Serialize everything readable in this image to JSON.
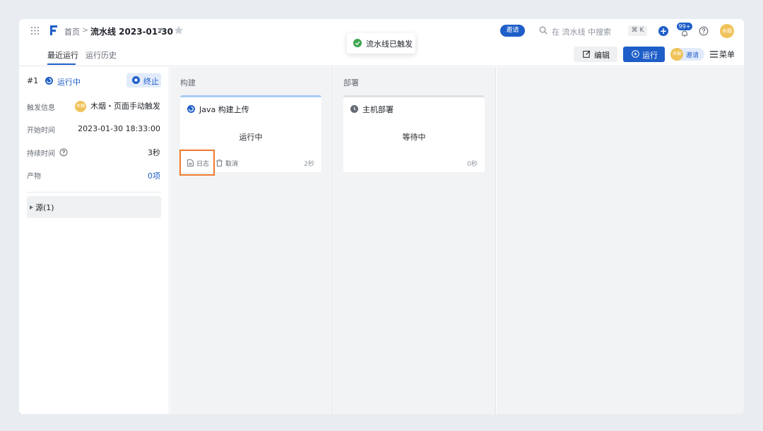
{
  "header": {
    "breadcrumb_home": "首页",
    "breadcrumb_sep": ">",
    "pipeline_title": "流水线 2023-01-30",
    "invite_label": "邀请",
    "search_placeholder": "在 流水线 中搜索",
    "shortcut": "⌘ K",
    "plus_label": "+",
    "notification_count": "99+",
    "avatar_text": "木烟"
  },
  "toast": {
    "message": "流水线已触发"
  },
  "tabs": {
    "recent": "最近运行",
    "history": "运行历史"
  },
  "toolbar": {
    "edit_label": "编辑",
    "run_label": "运行",
    "collab_avatar": "木烟",
    "collab_label": "邀请",
    "menu_label": "菜单"
  },
  "run": {
    "number": "#1",
    "status": "运行中",
    "stop_label": "终止",
    "trigger_label": "触发信息",
    "trigger_avatar": "木烟",
    "trigger_value": "木烟・页面手动触发",
    "start_label": "开始时间",
    "start_value": "2023-01-30 18:33:00",
    "duration_label": "持续时间",
    "duration_value": "3秒",
    "artifacts_label": "产物",
    "artifacts_value": "0项",
    "source_label": "源(1)"
  },
  "stages": [
    {
      "title": "构建",
      "job": {
        "name": "Java 构建上传",
        "status": "运行中",
        "log_label": "日志",
        "cancel_label": "取消",
        "duration": "2秒"
      }
    },
    {
      "title": "部署",
      "job": {
        "name": "主机部署",
        "status": "等待中",
        "duration": "0秒"
      }
    }
  ],
  "colors": {
    "accent": "#1e5ec8",
    "running_bar": "#a7cdf2",
    "waiting_bar": "#dee0e3",
    "success": "#3fa652",
    "highlight": "#ef7a2e",
    "avatar": "#f0c35a"
  },
  "icons": {
    "apps": "grid-icon",
    "logo": "logo-icon",
    "favorite": "star-icon",
    "search": "search-icon",
    "notifications": "bell-icon",
    "help": "help-icon",
    "edit": "edit-icon",
    "run": "play-icon",
    "menu": "menu-icon",
    "running": "loading-icon",
    "stop": "stop-icon",
    "waiting": "clock-icon",
    "log": "document-icon",
    "cancel": "trash-icon"
  }
}
